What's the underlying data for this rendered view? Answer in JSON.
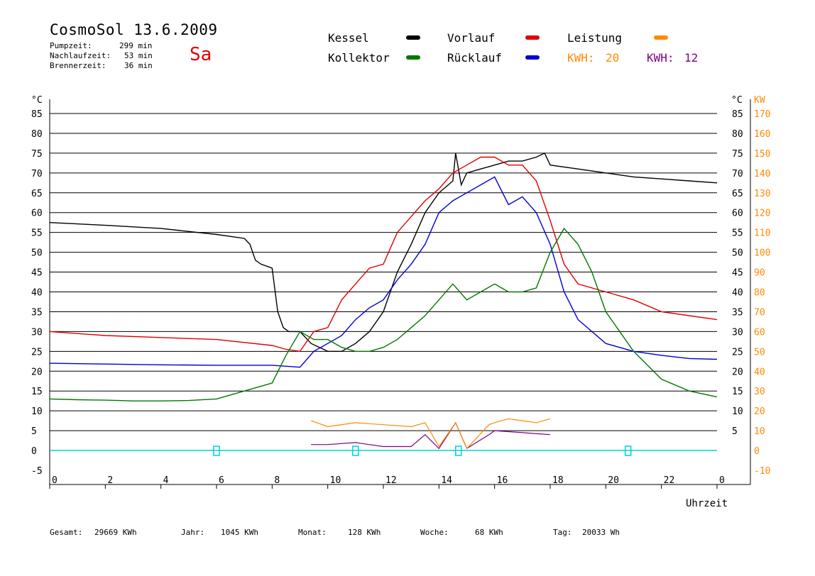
{
  "header": {
    "title": "CosmoSol 13.6.2009",
    "weekday": "Sa",
    "stats": [
      {
        "label": "Pumpzeit:",
        "value": "299 min"
      },
      {
        "label": "Nachlaufzeit:",
        "value": "53 min"
      },
      {
        "label": "Brennerzeit:",
        "value": "36 min"
      }
    ]
  },
  "legend": {
    "kessel": "Kessel",
    "kollektor": "Kollektor",
    "vorlauf": "Vorlauf",
    "ruecklauf": "Rücklauf",
    "leistung": "Leistung",
    "kwh1_label": "KWH:",
    "kwh1_value": "20",
    "kwh2_label": "KWH:",
    "kwh2_value": "12"
  },
  "colors": {
    "kessel": "#000000",
    "kollektor": "#007800",
    "vorlauf": "#e00000",
    "ruecklauf": "#0000d0",
    "leistung": "#ff8a00",
    "kwh2": "#800080",
    "pump": "#00d0e0",
    "weekday": "#e00000"
  },
  "chart_data": {
    "type": "line",
    "xlabel": "Uhrzeit",
    "x_ticks": [
      "0",
      "2",
      "4",
      "6",
      "8",
      "10",
      "12",
      "14",
      "16",
      "18",
      "20",
      "22",
      "0"
    ],
    "xlim": [
      0,
      24
    ],
    "ylim": [
      -5,
      85
    ],
    "y2lim": [
      -10,
      170
    ],
    "y_unit": "°C",
    "y2_unit": "KW",
    "y_ticks": [
      -5,
      0,
      5,
      10,
      15,
      20,
      25,
      30,
      35,
      40,
      45,
      50,
      55,
      60,
      65,
      70,
      75,
      80,
      85
    ],
    "right_ticks": [
      0,
      5,
      10,
      15,
      20,
      25,
      30,
      35,
      40,
      45,
      50,
      55,
      60,
      65,
      70,
      75,
      80,
      85
    ],
    "y2_ticks": [
      -10,
      0,
      10,
      20,
      30,
      40,
      50,
      60,
      70,
      80,
      90,
      100,
      110,
      120,
      130,
      140,
      150,
      160,
      170
    ],
    "grid": true,
    "series": [
      {
        "name": "Kessel",
        "color": "#000000",
        "x": [
          0,
          2,
          4,
          6,
          7,
          7.2,
          7.4,
          7.6,
          8,
          8.2,
          8.4,
          8.6,
          9,
          9.4,
          10,
          10.5,
          11,
          11.5,
          12,
          12.5,
          13,
          13.5,
          14,
          14.5,
          14.6,
          14.8,
          15,
          15.5,
          16,
          16.5,
          17,
          17.5,
          17.8,
          18,
          19,
          20,
          21,
          22,
          23,
          24
        ],
        "y": [
          57.5,
          56.8,
          56,
          54.5,
          53.5,
          52,
          48,
          47,
          46,
          35,
          31,
          30,
          30,
          27,
          25,
          25,
          27,
          30,
          35,
          45,
          52,
          60,
          65,
          68,
          75,
          67,
          70,
          71,
          72,
          73,
          73,
          74,
          75,
          72,
          71,
          70,
          69,
          68.5,
          68,
          67.5
        ]
      },
      {
        "name": "Vorlauf",
        "color": "#e00000",
        "x": [
          0,
          2,
          4,
          6,
          8,
          8.5,
          9,
          9.5,
          10,
          10.5,
          11,
          11.5,
          12,
          12.5,
          13,
          13.5,
          14,
          14.5,
          15,
          15.5,
          16,
          16.5,
          17,
          17.5,
          18,
          18.5,
          19,
          20,
          21,
          22,
          23,
          24
        ],
        "y": [
          30,
          29,
          28.5,
          28,
          26.5,
          25.5,
          25,
          30,
          31,
          38,
          42,
          46,
          47,
          55,
          59,
          63,
          66,
          70,
          72,
          74,
          74,
          72,
          72,
          68,
          58,
          47,
          42,
          40,
          38,
          35,
          34,
          33
        ]
      },
      {
        "name": "Rücklauf",
        "color": "#0000d0",
        "x": [
          0,
          2,
          4,
          6,
          8,
          9,
          9.5,
          10,
          10.5,
          11,
          11.5,
          12,
          12.5,
          13,
          13.5,
          14,
          14.5,
          15,
          15.5,
          16,
          16.5,
          17,
          17.5,
          18,
          18.5,
          19,
          20,
          21,
          22,
          23,
          24
        ],
        "y": [
          22,
          21.8,
          21.6,
          21.5,
          21.5,
          21,
          25,
          27,
          29,
          33,
          36,
          38,
          43,
          47,
          52,
          60,
          63,
          65,
          67,
          69,
          62,
          64,
          60,
          52,
          40,
          33,
          27,
          25,
          24,
          23.2,
          23
        ]
      },
      {
        "name": "Kollektor",
        "color": "#007800",
        "x": [
          0,
          1,
          2,
          3,
          4,
          5,
          6,
          7,
          8,
          8.5,
          9,
          9.5,
          10,
          10.5,
          11,
          11.5,
          12,
          12.5,
          13,
          13.5,
          14,
          14.5,
          15,
          15.5,
          16,
          16.5,
          17,
          17.5,
          18,
          18.5,
          19,
          19.5,
          20,
          21,
          22,
          23,
          24
        ],
        "y": [
          13,
          12.8,
          12.7,
          12.5,
          12.5,
          12.6,
          13,
          15,
          17,
          24,
          30,
          28,
          28,
          26,
          25,
          25,
          26,
          28,
          31,
          34,
          38,
          42,
          38,
          40,
          42,
          40,
          40,
          41,
          50,
          56,
          52,
          45,
          35,
          25,
          18,
          15,
          13.5
        ]
      }
    ],
    "power": {
      "name": "Leistung",
      "color": "#ff8a00",
      "x": [
        9.4,
        10,
        11,
        12,
        13,
        13.5,
        14,
        14.6,
        15,
        15.8,
        16,
        16.5,
        17,
        17.5,
        18
      ],
      "y": [
        15,
        12,
        14,
        13,
        12,
        14,
        2,
        14,
        1,
        13,
        14,
        16,
        15,
        14,
        16
      ]
    },
    "kwh2_series": {
      "color": "#800080",
      "x": [
        9.4,
        10,
        11,
        12,
        13,
        13.5,
        14,
        14.6,
        15,
        15.8,
        16,
        17,
        18
      ],
      "y": [
        3,
        3,
        4,
        2,
        2,
        8,
        1,
        14,
        1,
        8,
        10,
        9,
        8
      ]
    },
    "pump_marks": [
      6,
      11,
      14.7,
      20.8
    ],
    "totals": [
      {
        "label": "Gesamt:",
        "value": "29669 KWh"
      },
      {
        "label": "Jahr:",
        "value": "1045 KWh"
      },
      {
        "label": "Monat:",
        "value": "128 KWh"
      },
      {
        "label": "Woche:",
        "value": "68 KWh"
      },
      {
        "label": "Tag:",
        "value": "20033 Wh"
      }
    ]
  }
}
